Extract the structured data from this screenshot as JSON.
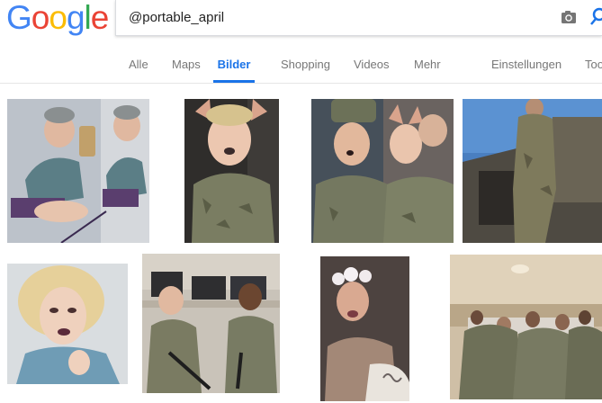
{
  "logo": {
    "text": [
      "G",
      "o",
      "o",
      "g",
      "l",
      "e"
    ],
    "colors": [
      "#4285F4",
      "#EA4335",
      "#FBBC05",
      "#4285F4",
      "#34A853",
      "#EA4335"
    ]
  },
  "search": {
    "query": "@portable_april"
  },
  "tabs": [
    {
      "label": "Alle"
    },
    {
      "label": "Maps"
    },
    {
      "label": "Bilder",
      "active": true
    },
    {
      "label": "Shopping"
    },
    {
      "label": "Videos"
    },
    {
      "label": "Mehr"
    },
    {
      "label": "Einstellungen"
    },
    {
      "label": "Tools"
    }
  ],
  "accent_color": "#1a73e8",
  "images": [
    {
      "name": "selfie-split-bathroom"
    },
    {
      "name": "selfie-dog-filter-uniform"
    },
    {
      "name": "selfie-two-filters-uniform"
    },
    {
      "name": "soldier-standing-vehicle"
    },
    {
      "name": "portrait-blonde-closeup"
    },
    {
      "name": "soldiers-computer-room"
    },
    {
      "name": "selfie-flower-crown"
    },
    {
      "name": "soldiers-group-prayer"
    }
  ]
}
